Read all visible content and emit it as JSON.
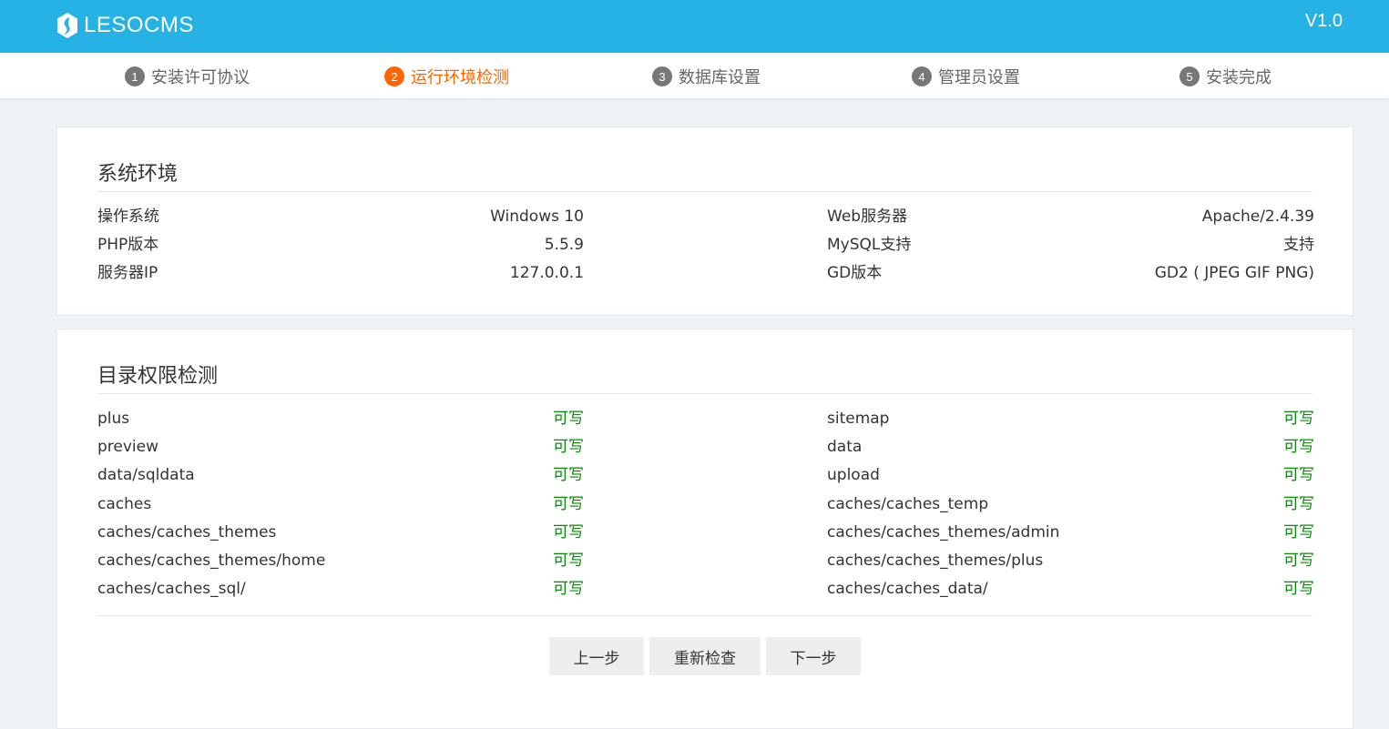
{
  "header": {
    "logo_text": "LESOCMS",
    "version": "V1.0"
  },
  "steps": [
    {
      "num": "1",
      "label": "安装许可协议",
      "active": false
    },
    {
      "num": "2",
      "label": "运行环境检测",
      "active": true
    },
    {
      "num": "3",
      "label": "数据库设置",
      "active": false
    },
    {
      "num": "4",
      "label": "管理员设置",
      "active": false
    },
    {
      "num": "5",
      "label": "安装完成",
      "active": false
    }
  ],
  "system": {
    "title": "系统环境",
    "left": [
      {
        "key": "操作系统",
        "value": "Windows 10"
      },
      {
        "key": "PHP版本",
        "value": "5.5.9"
      },
      {
        "key": "服务器IP",
        "value": "127.0.0.1"
      }
    ],
    "right": [
      {
        "key": "Web服务器",
        "value": "Apache/2.4.39"
      },
      {
        "key": "MySQL支持",
        "value": "支持"
      },
      {
        "key": "GD版本",
        "value": "GD2 ( JPEG GIF PNG)"
      }
    ]
  },
  "dirs": {
    "title": "目录权限检测",
    "left": [
      {
        "key": "plus",
        "value": "可写"
      },
      {
        "key": "preview",
        "value": "可写"
      },
      {
        "key": "data/sqldata",
        "value": "可写"
      },
      {
        "key": "caches",
        "value": "可写"
      },
      {
        "key": "caches/caches_themes",
        "value": "可写"
      },
      {
        "key": "caches/caches_themes/home",
        "value": "可写"
      },
      {
        "key": "caches/caches_sql/",
        "value": "可写"
      }
    ],
    "right": [
      {
        "key": "sitemap",
        "value": "可写"
      },
      {
        "key": "data",
        "value": "可写"
      },
      {
        "key": "upload",
        "value": "可写"
      },
      {
        "key": "caches/caches_temp",
        "value": "可写"
      },
      {
        "key": "caches/caches_themes/admin",
        "value": "可写"
      },
      {
        "key": "caches/caches_themes/plus",
        "value": "可写"
      },
      {
        "key": "caches/caches_data/",
        "value": "可写"
      }
    ]
  },
  "buttons": {
    "prev": "上一步",
    "recheck": "重新检查",
    "next": "下一步"
  },
  "colors": {
    "header_bg": "#27b2e6",
    "active_step": "#ff6600",
    "ok_status": "#0a8a0a"
  }
}
